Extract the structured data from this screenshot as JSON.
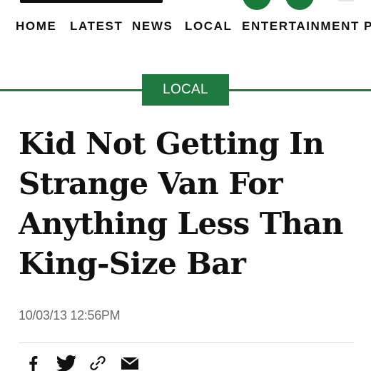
{
  "nav": {
    "items": [
      {
        "label": "HOME"
      },
      {
        "label": "LATEST"
      },
      {
        "label": "NEWS"
      },
      {
        "label": "LOCAL"
      },
      {
        "label": "ENTERTAINMENT"
      },
      {
        "label": "P"
      }
    ]
  },
  "section": {
    "label": "LOCAL"
  },
  "article": {
    "headline_lines": [
      "Kid Not Getting In",
      "Strange Van For",
      "Anything Less Than",
      "King-Size Bar"
    ],
    "date": "10/03/13 12:56PM"
  },
  "share": {
    "icons": [
      "facebook-icon",
      "twitter-icon",
      "link-icon",
      "email-icon"
    ]
  },
  "colors": {
    "accent": "#1e7a3f",
    "text": "#111111",
    "muted": "#6b6b6b",
    "rule": "#d9d9d9"
  }
}
